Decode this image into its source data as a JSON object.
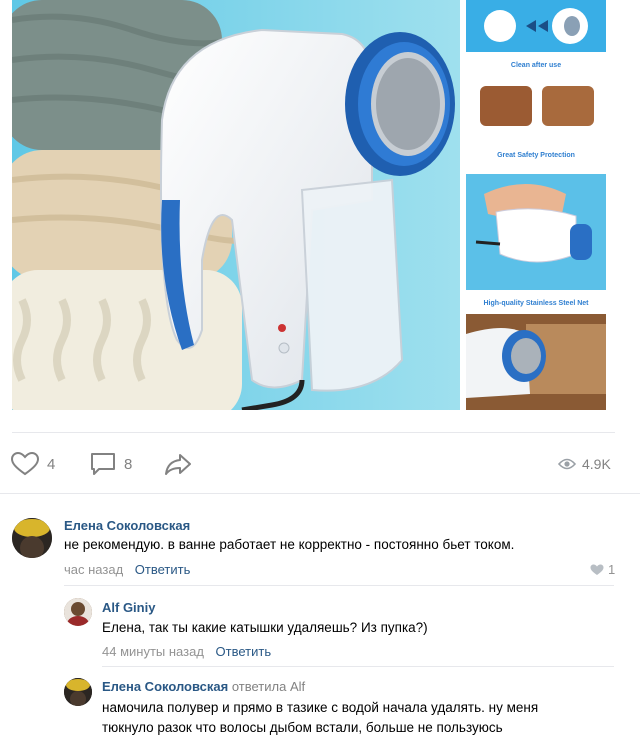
{
  "gallery": {
    "thumb_captions": [
      "Clean after use",
      "Great Safety Protection",
      "High-quality Stainless Steel Net"
    ]
  },
  "actions": {
    "likes": "4",
    "comments": "8",
    "views": "4.9K"
  },
  "comments": [
    {
      "author": "Елена Соколовская",
      "text": "не рекомендую. в ванне работает не корректно - постоянно бьет током.",
      "time": "час назад",
      "reply_label": "Ответить",
      "likes": "1"
    },
    {
      "author": "Alf Giniy",
      "text": "Елена, так ты какие катышки удаляешь? Из пупка?)",
      "time": "44 минуты назад",
      "reply_label": "Ответить"
    },
    {
      "author": "Елена Соколовская",
      "replied_to": "ответила Alf",
      "text_line1": "намочила полувер и прямо в тазике с водой начала удалять. ну меня",
      "text_line2": "тюкнуло разок что волосы дыбом встали, больше не пользуюсь"
    }
  ],
  "colors": {
    "link": "#2a5885",
    "muted": "#828282",
    "divider": "#e7e8ec",
    "product_blue": "#2a6fc4"
  }
}
